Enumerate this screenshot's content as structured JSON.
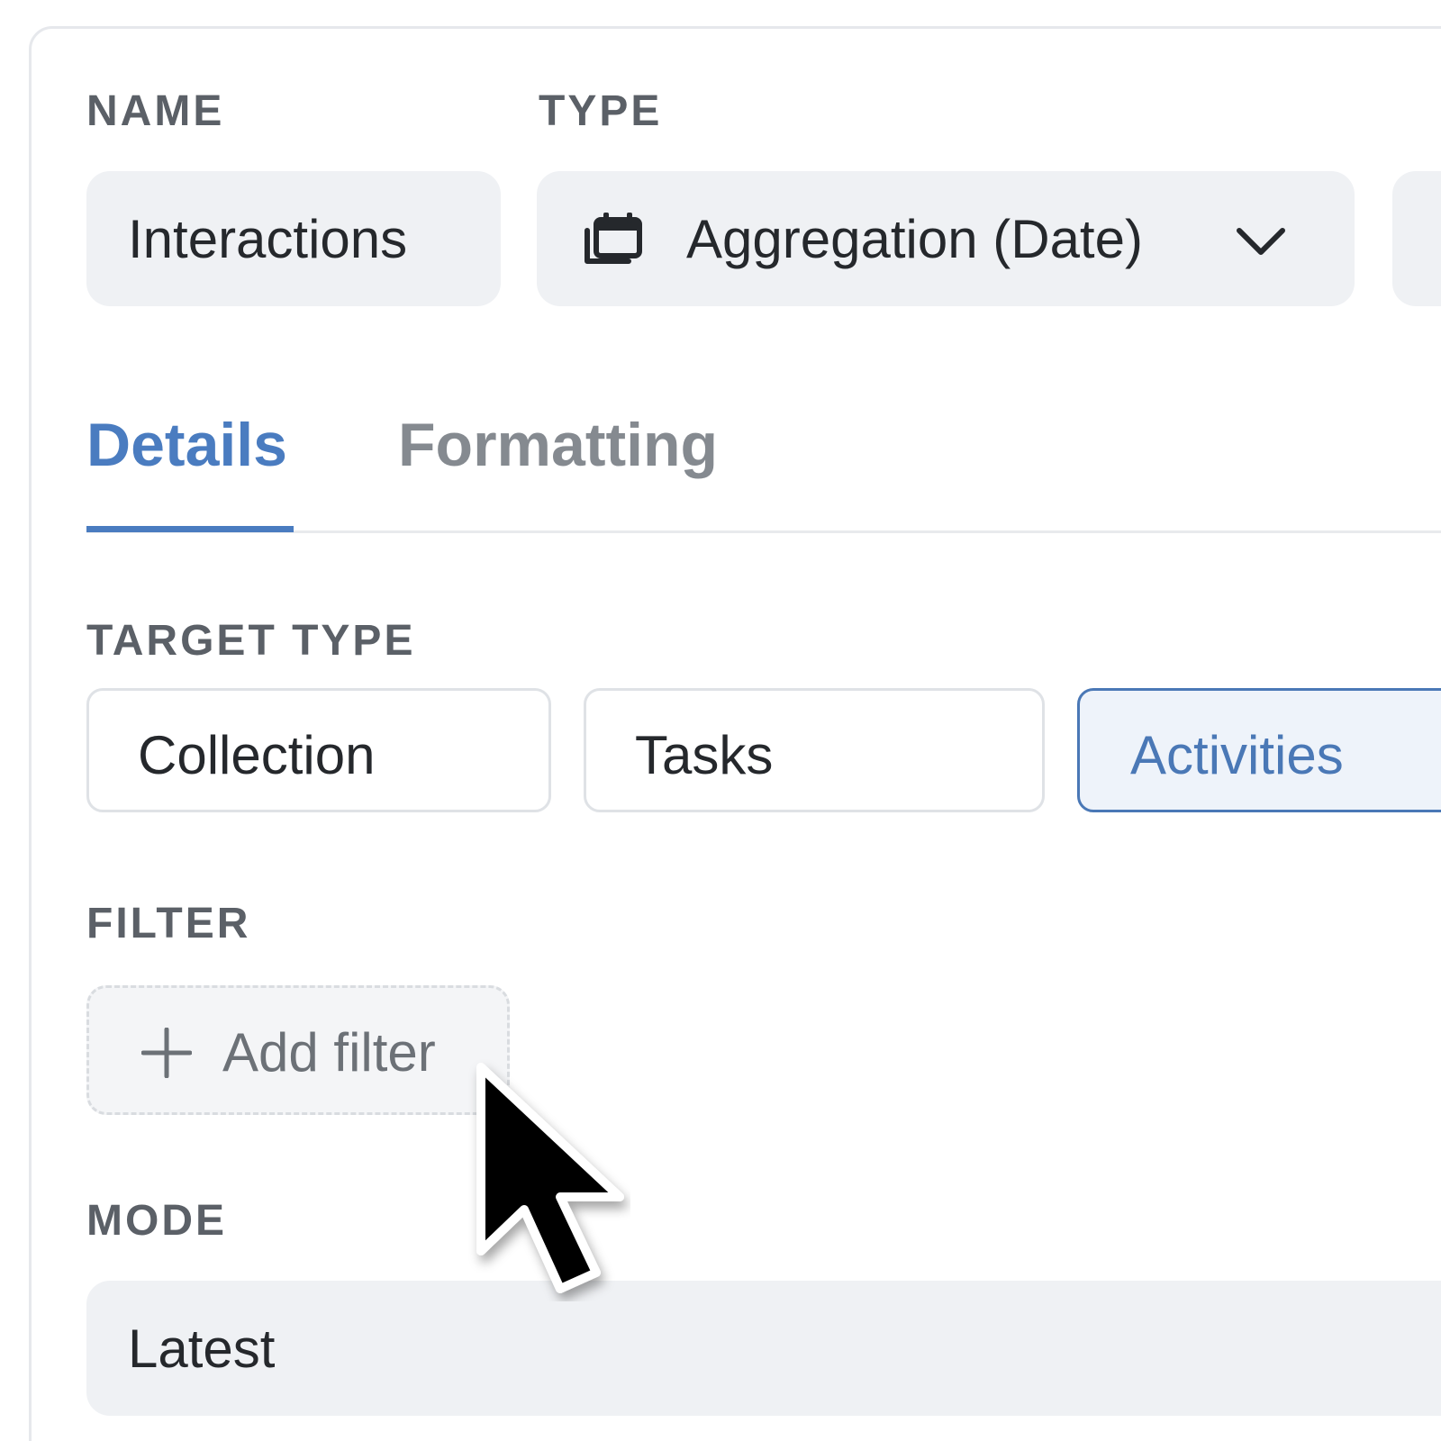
{
  "name": {
    "label": "NAME",
    "value": "Interactions"
  },
  "type": {
    "label": "TYPE",
    "value": "Aggregation (Date)",
    "icon": "calendar-stack-icon",
    "dropdown_icon": "chevron-down-icon"
  },
  "tabs": [
    {
      "label": "Details",
      "active": true
    },
    {
      "label": "Formatting",
      "active": false
    }
  ],
  "target_type": {
    "label": "TARGET TYPE",
    "options": [
      {
        "label": "Collection",
        "selected": false
      },
      {
        "label": "Tasks",
        "selected": false
      },
      {
        "label": "Activities",
        "selected": true
      }
    ]
  },
  "filter": {
    "label": "FILTER",
    "add_label": "Add filter",
    "add_icon": "plus-icon"
  },
  "mode": {
    "label": "MODE",
    "value": "Latest"
  },
  "colors": {
    "accent": "#4a7cc0",
    "field_bg": "#eff1f4",
    "label_text": "#5b6067",
    "selected_bg": "#eef3fa"
  }
}
